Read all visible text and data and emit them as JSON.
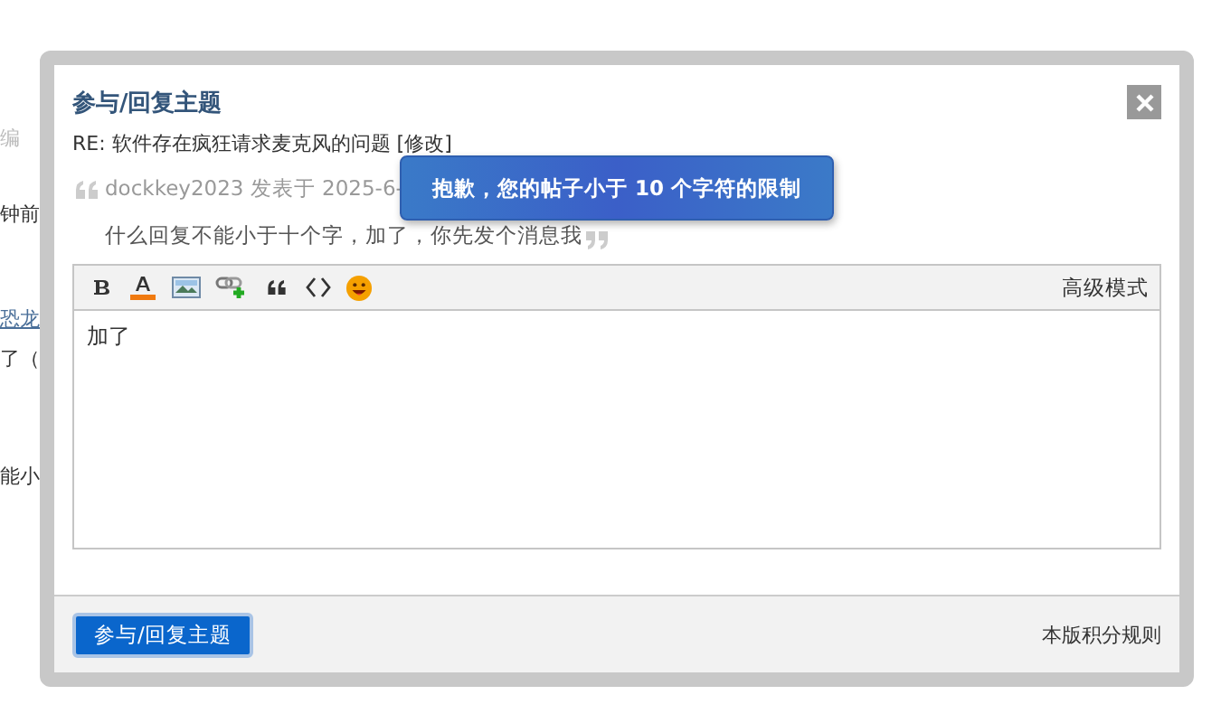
{
  "background_page": {
    "texts": [
      {
        "text": "编",
        "kind": "muted"
      },
      {
        "text": "钟前",
        "kind": "plain"
      },
      {
        "text": "恐龙",
        "kind": "link"
      },
      {
        "text": "了（",
        "kind": "plain"
      },
      {
        "text": "能小",
        "kind": "plain"
      }
    ]
  },
  "dialog": {
    "title": "参与/回复主题",
    "subject": "RE: 软件存在疯狂请求麦克风的问题",
    "edit_link": "[修改]",
    "quote": {
      "author_line": "dockkey2023 发表于 2025-6-",
      "body": "什么回复不能小于十个字，加了，你先发个消息我"
    },
    "toolbar": {
      "mode_link": "高级模式"
    },
    "editor_value": "加了",
    "submit": "参与/回复主题",
    "rules_link": "本版积分规则"
  },
  "toast": {
    "text": "抱歉，您的帖子小于 10 个字符的限制"
  }
}
